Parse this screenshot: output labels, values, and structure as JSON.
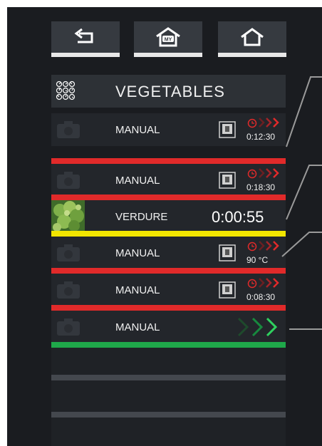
{
  "nav": {
    "buttons": [
      {
        "name": "back-button",
        "icon": "back-arrow-icon"
      },
      {
        "name": "my-recipes-button",
        "icon": "my-home-icon",
        "label": "MY"
      },
      {
        "name": "home-button",
        "icon": "home-icon"
      }
    ]
  },
  "header": {
    "title": "VEGETABLES",
    "icon": "multi-timer-grid-icon"
  },
  "rows": [
    {
      "label": "MANUAL",
      "mode": "oven-icon",
      "status": "clock-icon",
      "value": "0:12:30",
      "bar_color": "#e12a2a"
    },
    {
      "label": "MANUAL",
      "mode": "oven-icon",
      "status": "clock-icon",
      "value": "0:18:30",
      "bar_color": "#e12a2a"
    },
    {
      "label": "VERDURE",
      "value": "0:00:55",
      "bar_color": "#f2e600",
      "thumb": "broccoli-photo"
    },
    {
      "label": "MANUAL",
      "mode": "oven-icon",
      "status": "clock-icon",
      "value": "90 °C",
      "bar_color": "#e12a2a"
    },
    {
      "label": "MANUAL",
      "mode": "oven-icon",
      "status": "clock-icon",
      "value": "0:08:30",
      "bar_color": "#e12a2a"
    },
    {
      "label": "MANUAL",
      "status": "start-chevrons-icon",
      "bar_color": "#1fa84a"
    }
  ],
  "colors": {
    "screen_bg": "#1a1c20",
    "alarm_red": "#e12a2a",
    "active_yellow": "#f2e600",
    "ready_green": "#1fa84a"
  }
}
